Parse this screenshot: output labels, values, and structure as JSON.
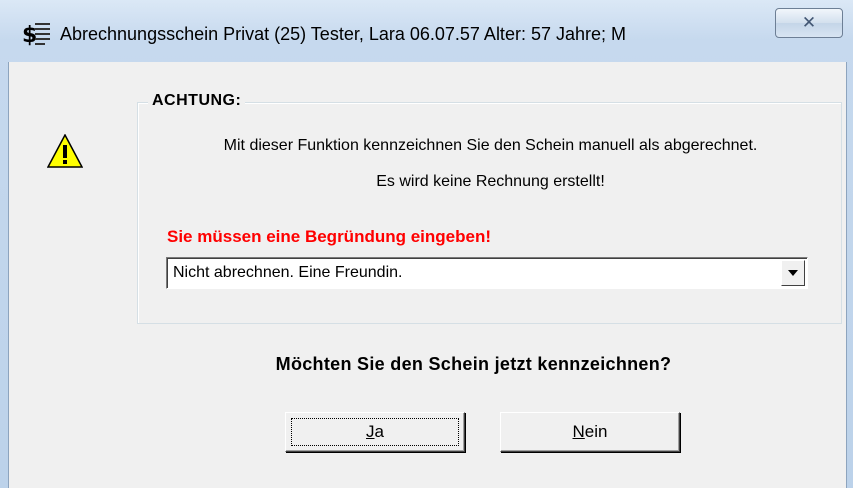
{
  "window": {
    "title": "Abrechnungsschein Privat (25) Tester, Lara 06.07.57 Alter: 57 Jahre; M",
    "close_label": "✕",
    "app_icon": "dollar-document-icon"
  },
  "dialog": {
    "warning_icon": "warning-triangle-icon",
    "group_title": "ACHTUNG:",
    "info_line_1": "Mit dieser Funktion kennzeichnen Sie den Schein manuell als abgerechnet.",
    "info_line_2": "Es wird keine Rechnung erstellt!",
    "required_prompt": "Sie müssen eine Begründung eingeben!",
    "reason_value": "Nicht abrechnen. Eine Freundin.",
    "question": "Möchten Sie den Schein jetzt kennzeichnen?",
    "yes_mnemonic": "J",
    "yes_rest": "a",
    "no_mnemonic": "N",
    "no_rest": "ein"
  },
  "colors": {
    "required_text": "#ff0000",
    "frame": "#c6d9ee"
  }
}
